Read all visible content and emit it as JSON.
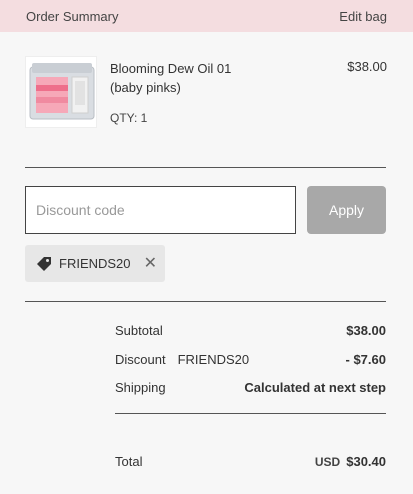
{
  "header": {
    "title": "Order Summary",
    "edit_label": "Edit bag"
  },
  "product": {
    "name": "Blooming Dew Oil 01 (baby pinks)",
    "price": "$38.00",
    "qty": "QTY: 1"
  },
  "discount": {
    "placeholder": "Discount code",
    "apply_label": "Apply",
    "applied_code": "FRIENDS20"
  },
  "summary": {
    "subtotal_label": "Subtotal",
    "subtotal_value": "$38.00",
    "discount_label": "Discount",
    "discount_code": "FRIENDS20",
    "discount_value": "- $7.60",
    "shipping_label": "Shipping",
    "shipping_value": "Calculated at next step",
    "total_label": "Total",
    "total_currency": "USD",
    "total_value": "$30.40"
  },
  "colors": {
    "header_bg": "#f4dde0",
    "apply_bg": "#a8a8a8",
    "chip_bg": "#e7e7e7"
  }
}
